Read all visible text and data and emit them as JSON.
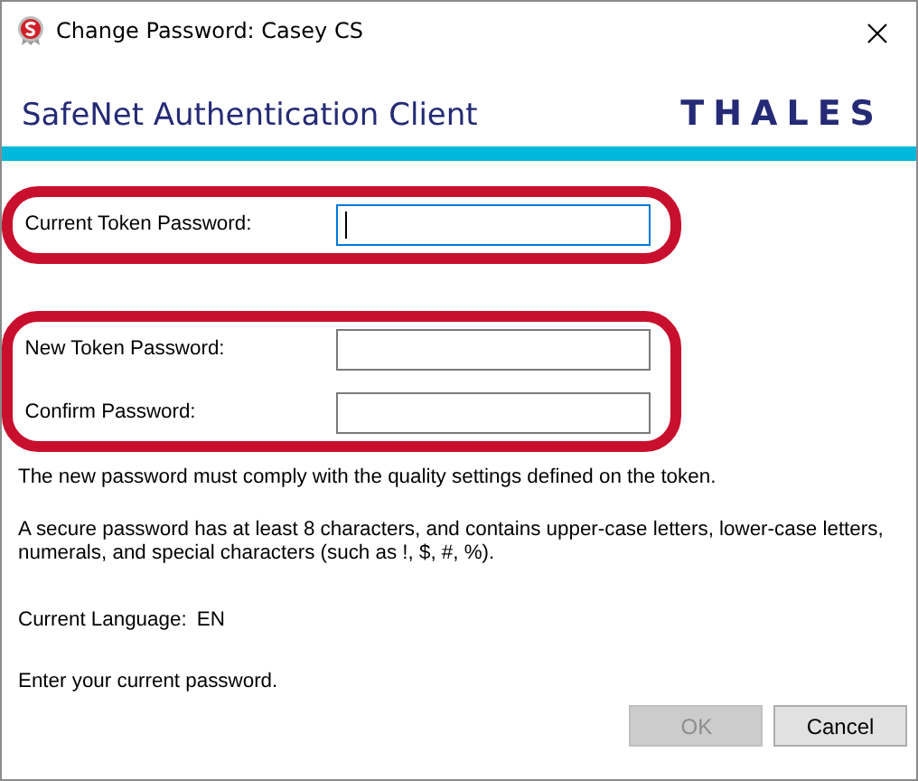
{
  "window": {
    "title": "Change Password: Casey CS"
  },
  "header": {
    "product": "SafeNet Authentication Client",
    "brand": "THALES"
  },
  "field_groups": [
    {
      "fields": [
        {
          "label": "Current Token Password:",
          "focused": true
        }
      ]
    },
    {
      "fields": [
        {
          "label": "New Token Password:",
          "focused": false
        },
        {
          "label": "Confirm Password:",
          "focused": false
        }
      ]
    }
  ],
  "messages": [
    "The new password must comply with the quality settings defined on the token.",
    "A secure password has at least 8 characters, and contains upper-case letters, lower-case letters, numerals, and special characters (such as !, $, #, %)."
  ],
  "language": {
    "label": "Current Language:",
    "value": "EN"
  },
  "status": "Enter your current password.",
  "buttons": [
    {
      "label": "OK",
      "disabled": true
    },
    {
      "label": "Cancel",
      "disabled": false
    }
  ]
}
